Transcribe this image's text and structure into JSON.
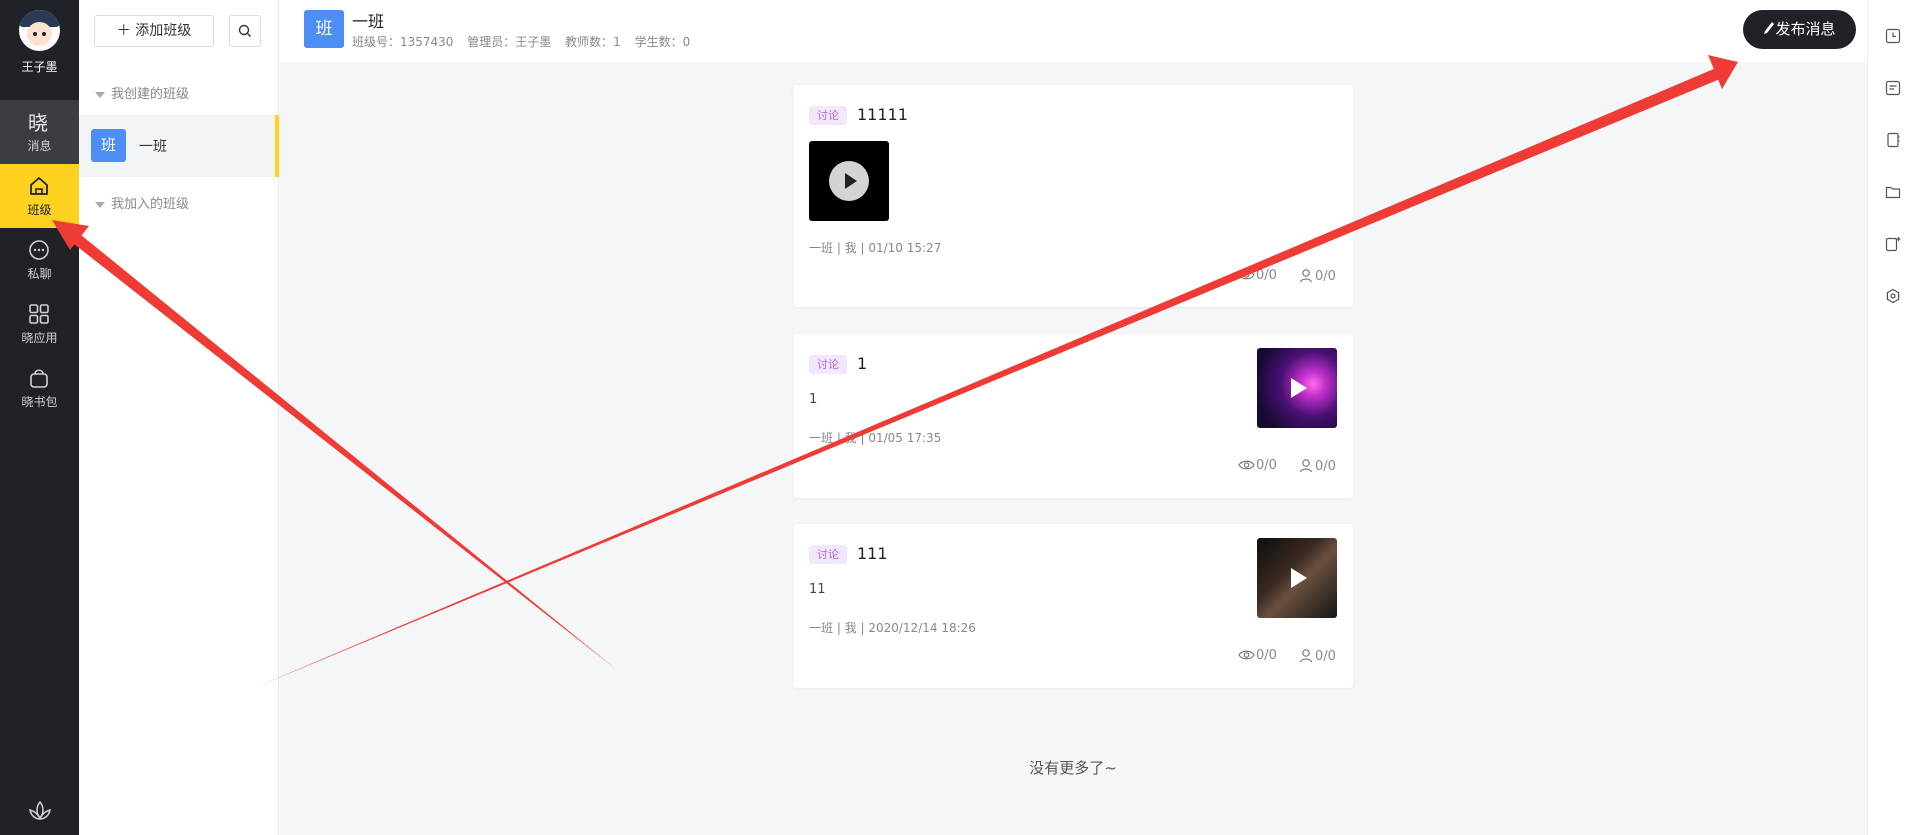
{
  "user": {
    "name": "王子墨"
  },
  "rail": [
    {
      "icon": "xiao-logo-icon",
      "label": "消息",
      "state": "dim"
    },
    {
      "icon": "home-icon",
      "label": "班级",
      "state": "active"
    },
    {
      "icon": "chat-icon",
      "label": "私聊",
      "state": "normal"
    },
    {
      "icon": "apps-grid-icon",
      "label": "晓应用",
      "state": "normal"
    },
    {
      "icon": "bag-icon",
      "label": "晓书包",
      "state": "normal"
    }
  ],
  "panel": {
    "add_label": "添加班级",
    "created_group": "我创建的班级",
    "joined_group": "我加入的班级",
    "classes": [
      {
        "badge": "班",
        "name": "一班"
      }
    ]
  },
  "header": {
    "badge": "班",
    "title": "一班",
    "class_no": "班级号：1357430",
    "admin": "管理员：王子墨",
    "teachers": "教师数：1",
    "students": "学生数：0",
    "publish_label": "发布消息"
  },
  "posts": [
    {
      "tag": "讨论",
      "title": "11111",
      "body": "",
      "meta": "一班 | 我 | 01/10 15:27",
      "views": "0/0",
      "replies": "0/0",
      "thumb": "black-video"
    },
    {
      "tag": "讨论",
      "title": "1",
      "body": "1",
      "meta": "一班 | 我 | 01/05 17:35",
      "views": "0/0",
      "replies": "0/0",
      "thumb": "galaxy-video"
    },
    {
      "tag": "讨论",
      "title": "111",
      "body": "11",
      "meta": "一班 | 我 | 2020/12/14 18:26",
      "views": "0/0",
      "replies": "0/0",
      "thumb": "dark-scene-video"
    }
  ],
  "footer_text": "没有更多了~",
  "colors": {
    "accent": "#ffd21f",
    "rail_bg": "#1f2226",
    "badge_blue": "#4c8df6",
    "tag_purple": "#b06ad6",
    "arrow_red": "#ef3b36"
  }
}
